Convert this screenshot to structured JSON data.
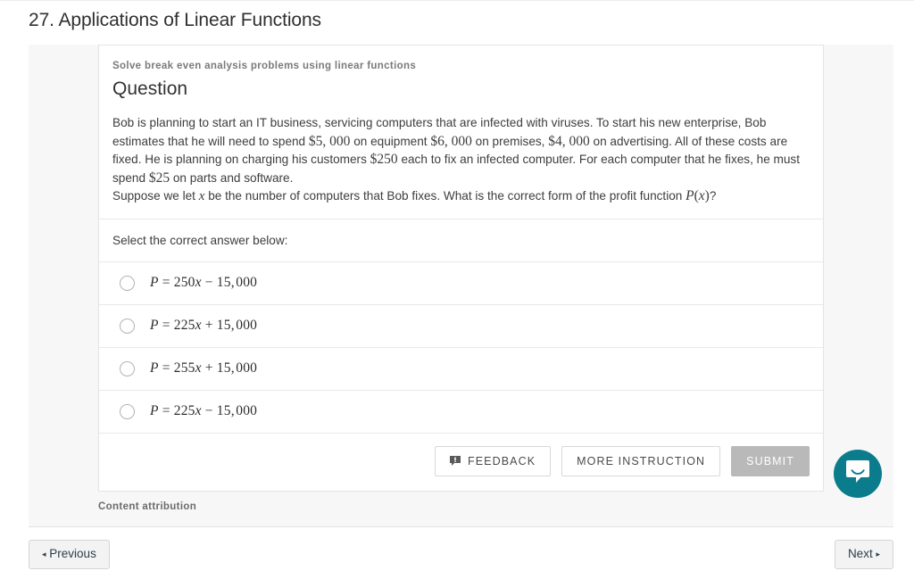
{
  "page": {
    "title": "27. Applications of Linear Functions"
  },
  "card": {
    "objective": "Solve break even analysis problems using linear functions",
    "heading": "Question",
    "body_line1": "Bob is planning to start an IT business, servicing computers that are infected with viruses. To start his new enterprise, Bob estimates that he will need to spend",
    "amount_equipment": "$5, 000",
    "body_line2": "on equipment",
    "amount_premises": "$6, 000",
    "body_line3": "on premises,",
    "amount_advertising": "$4, 000",
    "body_line4": "on advertising. All of these costs are fixed. He is planning on charging his customers",
    "amount_charge": "$250",
    "body_line5": "each to fix an infected computer. For each computer that he fixes, he must spend",
    "amount_parts": "$25",
    "body_line6": "on parts and software.",
    "body_line7_pre": "Suppose we let",
    "var_x": "x",
    "body_line7_mid": "be the number of computers that Bob fixes. What is the correct form of the profit function",
    "profit_fn": "P(x)",
    "body_line7_post": "?",
    "select_prompt": "Select the correct answer below:",
    "attribution": "Content attribution"
  },
  "options": [
    {
      "id": "option-a",
      "lhs": "P",
      "eq": "=",
      "coef": "250",
      "var": "x",
      "sign": "−",
      "constant": "15, 000",
      "full": "P = 250x − 15, 000"
    },
    {
      "id": "option-b",
      "lhs": "P",
      "eq": "=",
      "coef": "225",
      "var": "x",
      "sign": "+",
      "constant": "15, 000",
      "full": "P = 225x + 15, 000"
    },
    {
      "id": "option-c",
      "lhs": "P",
      "eq": "=",
      "coef": "255",
      "var": "x",
      "sign": "+",
      "constant": "15, 000",
      "full": "P = 255x + 15, 000"
    },
    {
      "id": "option-d",
      "lhs": "P",
      "eq": "=",
      "coef": "225",
      "var": "x",
      "sign": "−",
      "constant": "15, 000",
      "full": "P = 225x − 15, 000"
    }
  ],
  "actions": {
    "feedback": "FEEDBACK",
    "more_instruction": "MORE INSTRUCTION",
    "submit": "SUBMIT"
  },
  "footer": {
    "previous": "Previous",
    "next": "Next",
    "prev_arrow": "◂",
    "next_arrow": "▸"
  },
  "icons": {
    "feedback": "feedback-bubble-icon",
    "chat": "chat-bubble-smile-icon"
  },
  "colors": {
    "chat_teal": "#0b7c8c",
    "submit_gray": "#b9b9b9",
    "shell_gray": "#f7f7f7"
  }
}
